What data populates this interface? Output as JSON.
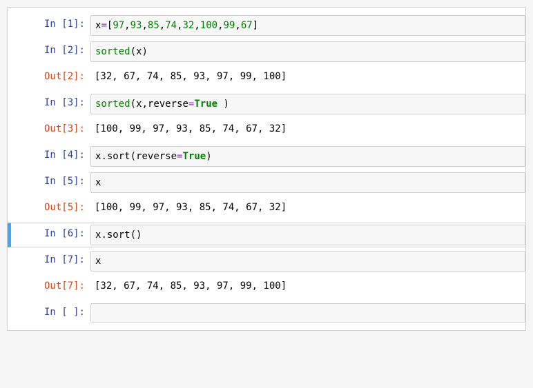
{
  "cells": [
    {
      "type": "in",
      "n": "1",
      "code": [
        {
          "t": "x",
          "c": "tok-name"
        },
        {
          "t": "=",
          "c": "tok-op"
        },
        {
          "t": "[",
          "c": "tok-punc"
        },
        {
          "t": "97",
          "c": "tok-num"
        },
        {
          "t": ",",
          "c": "tok-punc"
        },
        {
          "t": "93",
          "c": "tok-num"
        },
        {
          "t": ",",
          "c": "tok-punc"
        },
        {
          "t": "85",
          "c": "tok-num"
        },
        {
          "t": ",",
          "c": "tok-punc"
        },
        {
          "t": "74",
          "c": "tok-num"
        },
        {
          "t": ",",
          "c": "tok-punc"
        },
        {
          "t": "32",
          "c": "tok-num"
        },
        {
          "t": ",",
          "c": "tok-punc"
        },
        {
          "t": "100",
          "c": "tok-num"
        },
        {
          "t": ",",
          "c": "tok-punc"
        },
        {
          "t": "99",
          "c": "tok-num"
        },
        {
          "t": ",",
          "c": "tok-punc"
        },
        {
          "t": "67",
          "c": "tok-num"
        },
        {
          "t": "]",
          "c": "tok-punc"
        }
      ]
    },
    {
      "type": "in",
      "n": "2",
      "code": [
        {
          "t": "sorted",
          "c": "tok-func"
        },
        {
          "t": "(",
          "c": "tok-punc"
        },
        {
          "t": "x",
          "c": "tok-name"
        },
        {
          "t": ")",
          "c": "tok-punc"
        }
      ]
    },
    {
      "type": "out",
      "n": "2",
      "text": "[32, 67, 74, 85, 93, 97, 99, 100]"
    },
    {
      "type": "in",
      "n": "3",
      "code": [
        {
          "t": "sorted",
          "c": "tok-func"
        },
        {
          "t": "(",
          "c": "tok-punc"
        },
        {
          "t": "x",
          "c": "tok-name"
        },
        {
          "t": ",",
          "c": "tok-punc"
        },
        {
          "t": "reverse",
          "c": "tok-param"
        },
        {
          "t": "=",
          "c": "tok-op"
        },
        {
          "t": "True",
          "c": "tok-kw"
        },
        {
          "t": " ",
          "c": "tok-punc"
        },
        {
          "t": ")",
          "c": "tok-punc"
        }
      ]
    },
    {
      "type": "out",
      "n": "3",
      "text": "[100, 99, 97, 93, 85, 74, 67, 32]"
    },
    {
      "type": "in",
      "n": "4",
      "code": [
        {
          "t": "x",
          "c": "tok-name"
        },
        {
          "t": ".",
          "c": "tok-punc"
        },
        {
          "t": "sort",
          "c": "tok-name"
        },
        {
          "t": "(",
          "c": "tok-punc"
        },
        {
          "t": "reverse",
          "c": "tok-param"
        },
        {
          "t": "=",
          "c": "tok-op"
        },
        {
          "t": "True",
          "c": "tok-kw"
        },
        {
          "t": ")",
          "c": "tok-punc"
        }
      ]
    },
    {
      "type": "in",
      "n": "5",
      "code": [
        {
          "t": "x",
          "c": "tok-name"
        }
      ]
    },
    {
      "type": "out",
      "n": "5",
      "text": "[100, 99, 97, 93, 85, 74, 67, 32]"
    },
    {
      "type": "in",
      "n": "6",
      "selected": true,
      "code": [
        {
          "t": "x",
          "c": "tok-name"
        },
        {
          "t": ".",
          "c": "tok-punc"
        },
        {
          "t": "sort",
          "c": "tok-name"
        },
        {
          "t": "(",
          "c": "tok-punc"
        },
        {
          "t": ")",
          "c": "tok-punc"
        }
      ]
    },
    {
      "type": "in",
      "n": "7",
      "code": [
        {
          "t": "x",
          "c": "tok-name"
        }
      ]
    },
    {
      "type": "out",
      "n": "7",
      "text": "[32, 67, 74, 85, 93, 97, 99, 100]"
    },
    {
      "type": "in",
      "n": " ",
      "code": []
    }
  ],
  "labels": {
    "in_prefix": "In  [",
    "in_suffix": "]:",
    "out_prefix": "Out[",
    "out_suffix": "]:"
  }
}
